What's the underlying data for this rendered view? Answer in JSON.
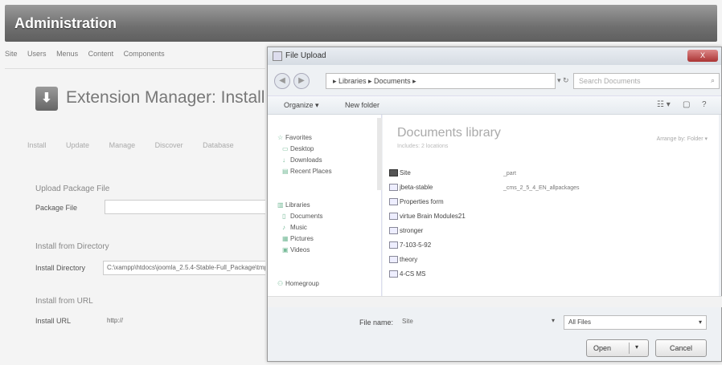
{
  "header": {
    "title": "Administration"
  },
  "menu": [
    "Site",
    "Users",
    "Menus",
    "Content",
    "Components"
  ],
  "page": {
    "icon_text": "⬇",
    "title": "Extension Manager: Install",
    "tabs": [
      "Install",
      "Update",
      "Manage",
      "Discover",
      "Database"
    ]
  },
  "upload_section": {
    "title": "Upload Package File",
    "label": "Package File"
  },
  "directory_section": {
    "title": "Install from Directory",
    "label": "Install Directory",
    "value": "C:\\xampp\\htdocs\\joomla_2.5.4-Stable-Full_Package\\tmp"
  },
  "url_section": {
    "title": "Install from URL",
    "label": "Install URL",
    "value": "http://"
  },
  "dialog": {
    "title": "File Upload",
    "close_label": "X",
    "back_symbol": "◀",
    "forward_symbol": "▶",
    "address": "▸ Libraries ▸ Documents ▸",
    "address_arrows": "▾ ↻",
    "search_placeholder": "Search Documents",
    "search_symbol": "⌕",
    "toolbar": {
      "organize": "Organize ▾",
      "new_folder": "New folder",
      "view_symbol": "☷ ▾",
      "pane_symbol": "▢",
      "help_symbol": "?"
    },
    "nav": {
      "favorites": "Favorites",
      "desktop": "Desktop",
      "downloads": "Downloads",
      "recent": "Recent Places",
      "libraries": "Libraries",
      "documents": "Documents",
      "music": "Music",
      "pictures": "Pictures",
      "videos": "Videos",
      "homegroup": "Homegroup"
    },
    "library": {
      "title": "Documents library",
      "subtitle": "Includes: 2 locations",
      "arrange": "Arrange by: Folder ▾"
    },
    "files": [
      {
        "name": "Site",
        "date": "_part"
      },
      {
        "name": "jbeta-stable",
        "date": "_cms_2_5_4_EN_allpackages"
      },
      {
        "name": "Properties form"
      },
      {
        "name": "virtue Brain Modules21"
      },
      {
        "name": "stronger"
      },
      {
        "name": "7-103-5-92"
      },
      {
        "name": "theory"
      },
      {
        "name": "4-CS MS"
      }
    ],
    "file_name_label": "File name:",
    "file_name_value": "Site",
    "file_type": "All Files",
    "open_label": "Open",
    "cancel_label": "Cancel"
  }
}
